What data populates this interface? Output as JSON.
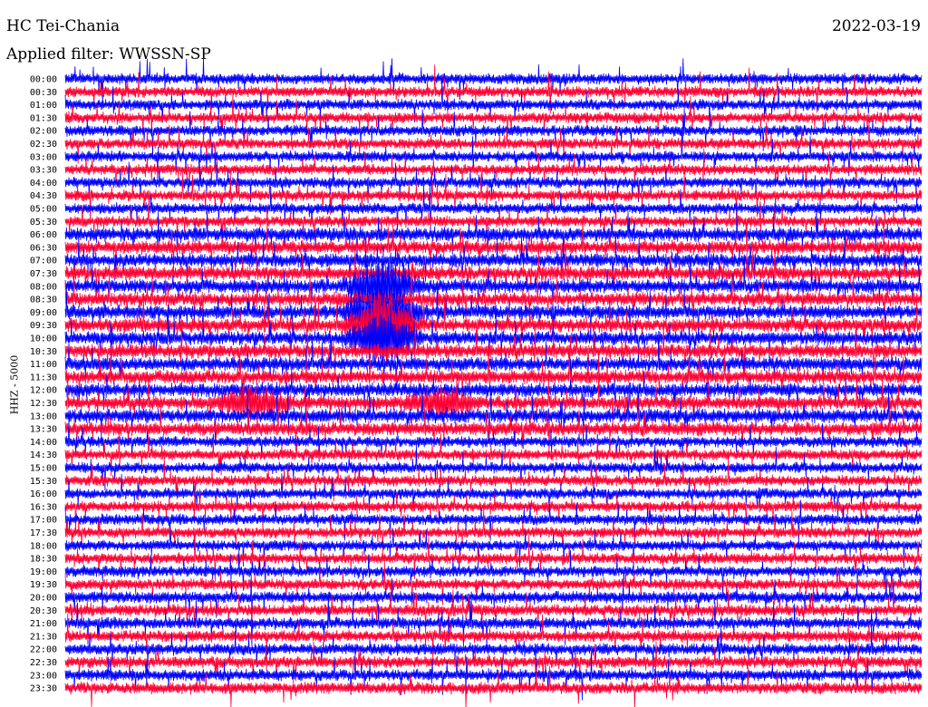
{
  "header": {
    "title": "HC Tei-Chania",
    "date": "2022-03-19",
    "filter": "Applied filter: WWSSN-SP"
  },
  "chart_data": {
    "type": "line",
    "title": "HC Tei-Chania",
    "subtitle": "Applied filter: WWSSN-SP",
    "ylabel": "HHZ - 5000",
    "xlabel": "",
    "row_labels": [
      "00:00",
      "00:30",
      "01:00",
      "01:30",
      "02:00",
      "02:30",
      "03:00",
      "03:30",
      "04:00",
      "04:30",
      "05:00",
      "05:30",
      "06:00",
      "06:30",
      "07:00",
      "07:30",
      "08:00",
      "08:30",
      "09:00",
      "09:30",
      "10:00",
      "10:30",
      "11:00",
      "11:30",
      "12:00",
      "12:30",
      "13:00",
      "13:30",
      "14:00",
      "14:30",
      "15:00",
      "15:30",
      "16:00",
      "16:30",
      "17:00",
      "17:30",
      "18:00",
      "18:30",
      "19:00",
      "19:30",
      "20:00",
      "20:30",
      "21:00",
      "21:30",
      "22:00",
      "22:30",
      "23:00",
      "23:30"
    ],
    "series_colors": [
      "#0000ff",
      "#ff0033"
    ],
    "grid": false,
    "legend": "none",
    "rows": 48,
    "events": [
      {
        "row_label": "08:00",
        "x_fraction": 0.37,
        "intensity": 1.0
      },
      {
        "row_label": "09:00",
        "x_fraction": 0.37,
        "intensity": 1.0
      },
      {
        "row_label": "09:30",
        "x_fraction": 0.37,
        "intensity": 1.0
      },
      {
        "row_label": "10:00",
        "x_fraction": 0.37,
        "intensity": 0.9
      },
      {
        "row_label": "12:30",
        "x_fraction": 0.22,
        "intensity": 0.5
      },
      {
        "row_label": "12:30",
        "x_fraction": 0.44,
        "intensity": 0.4
      }
    ]
  }
}
